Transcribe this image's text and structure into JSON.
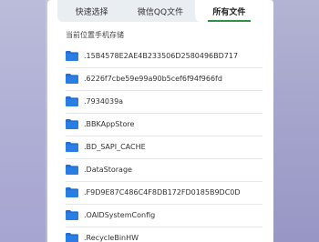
{
  "tabs": [
    {
      "label": "快速选择"
    },
    {
      "label": "微信QQ文件"
    },
    {
      "label": "所有文件"
    }
  ],
  "current_location": "当前位置手机存储",
  "files": [
    {
      "name": ".15B4578E2AE4B233506D2580496BD717"
    },
    {
      "name": ".6226f7cbe59e99a90b5cef6f94f966fd"
    },
    {
      "name": ".7934039a"
    },
    {
      "name": ".BBKAppStore"
    },
    {
      "name": ".BD_SAPI_CACHE"
    },
    {
      "name": ".DataStorage"
    },
    {
      "name": ".F9D9E87C486C4F8DB172FD0185B9DC0D"
    },
    {
      "name": ".OAIDSystemConfig"
    },
    {
      "name": ".RecycleBinHW"
    }
  ],
  "colors": {
    "folder": "#1f6fd6",
    "active_tab_underline": "#2f8f4c"
  },
  "icons": {
    "folder": "folder-icon"
  }
}
